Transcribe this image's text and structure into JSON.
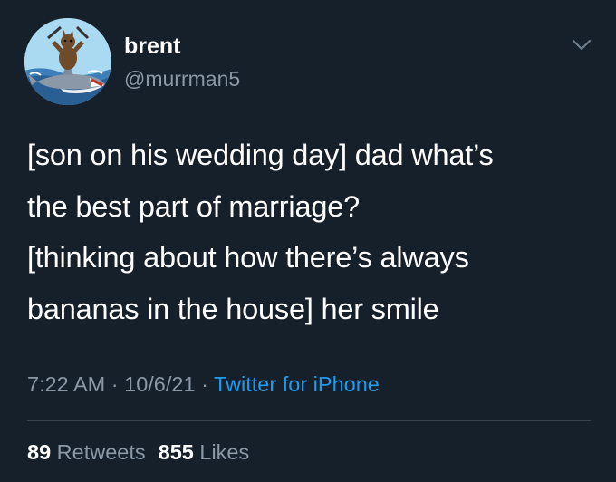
{
  "tweet": {
    "author": {
      "display_name": "brent",
      "handle": "@murrman5"
    },
    "text_lines": [
      "[son on his wedding day] dad what’s",
      "the best part of marriage?",
      "[thinking about how there’s always",
      "bananas in the house] her smile"
    ],
    "time": "7:22 AM",
    "date": "10/6/21",
    "separator": "·",
    "source": "Twitter for iPhone",
    "stats": {
      "retweets_count": "89",
      "retweets_label": "Retweets",
      "likes_count": "855",
      "likes_label": "Likes"
    }
  },
  "icons": {
    "caret": "chevron-down-icon",
    "avatar": "cat-on-shark-avatar"
  },
  "colors": {
    "background": "#15202b",
    "text_primary": "#ffffff",
    "text_secondary": "#8b98a5",
    "link": "#1d9bf0",
    "divider": "#38444d"
  }
}
